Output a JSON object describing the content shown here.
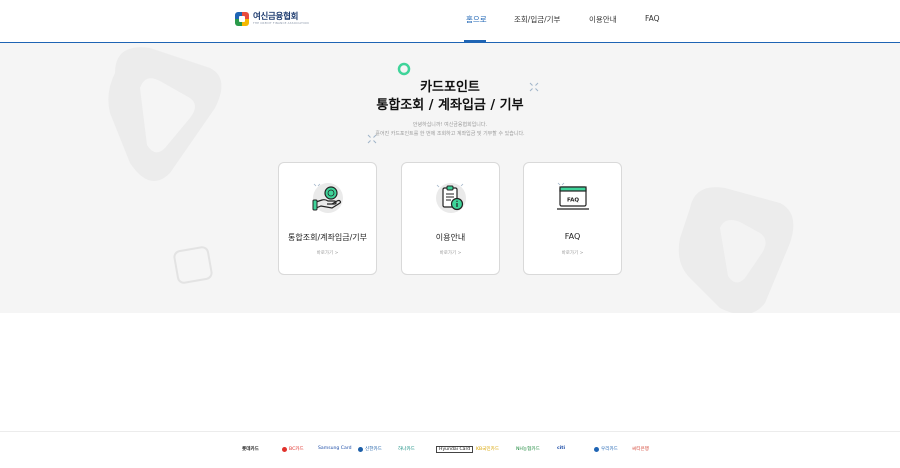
{
  "header": {
    "logo": {
      "name": "여신금융협회",
      "sub": "THE CREDIT FINANCE ASSOCIATION"
    },
    "nav": [
      {
        "label": "홈으로",
        "active": true
      },
      {
        "label": "조회/입금/기부",
        "active": false
      },
      {
        "label": "이용안내",
        "active": false
      },
      {
        "label": "FAQ",
        "active": false
      }
    ]
  },
  "hero": {
    "title_line1": "카드포인트",
    "title_line2": "통합조회 / 계좌입금 / 기부",
    "desc_line1": "안녕하십니까! 여신금융협회입니다.",
    "desc_line2": "흩어진 카드포인트를 한 번에 조회하고 계좌입금 및 기부할 수 있습니다."
  },
  "cards": [
    {
      "title": "통합조회/계좌입금/기부",
      "more": "바로가기 >",
      "icon": "coin-hand-icon"
    },
    {
      "title": "이용안내",
      "more": "바로가기 >",
      "icon": "clipboard-info-icon"
    },
    {
      "title": "FAQ",
      "more": "바로가기 >",
      "icon": "faq-screen-icon"
    }
  ],
  "footer": {
    "partners": [
      {
        "name": "롯데카드",
        "color": "#222222"
      },
      {
        "name": "BC카드",
        "color": "#e0312b"
      },
      {
        "name": "Samsung Card",
        "color": "#1e4ea8"
      },
      {
        "name": "신한카드",
        "color": "#1d5fa8"
      },
      {
        "name": "하나카드",
        "color": "#0f8a7e"
      },
      {
        "name": "Hyundai Card",
        "color": "#222222"
      },
      {
        "name": "KB국민카드",
        "color": "#d9a400"
      },
      {
        "name": "NH농협카드",
        "color": "#1e8a3e"
      },
      {
        "name": "citi",
        "color": "#1e4ea8"
      },
      {
        "name": "우리카드",
        "color": "#1e64b4"
      },
      {
        "name": "씨티은행",
        "color": "#d13b2b"
      }
    ]
  },
  "colors": {
    "accent": "#1e64b4",
    "mint": "#3fd49a",
    "hero_bg": "#f5f5f5"
  }
}
